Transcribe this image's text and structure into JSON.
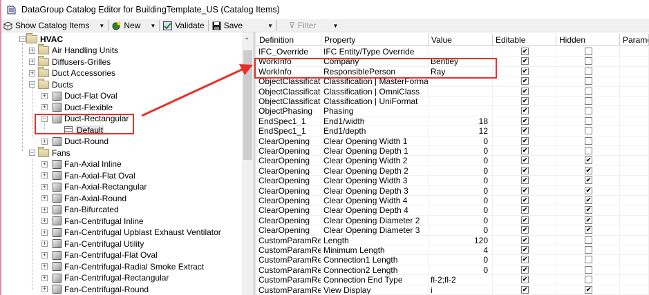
{
  "window": {
    "title": "DataGroup Catalog Editor for BuildingTemplate_US (Catalog Items)"
  },
  "toolbar": {
    "show_catalog_items": "Show Catalog Items",
    "new": "New",
    "validate": "Validate",
    "save": "Save",
    "filter": "Filter"
  },
  "tree": [
    {
      "label": "HVAC",
      "level": 1,
      "exp": "-",
      "icon": "folder",
      "bold": true
    },
    {
      "label": "Air Handling Units",
      "level": 2,
      "exp": "+",
      "icon": "folder"
    },
    {
      "label": "Diffusers-Grilles",
      "level": 2,
      "exp": "+",
      "icon": "folder"
    },
    {
      "label": "Duct Accessories",
      "level": 2,
      "exp": "+",
      "icon": "folder"
    },
    {
      "label": "Ducts",
      "level": 2,
      "exp": "-",
      "icon": "folder"
    },
    {
      "label": "Duct-Flat Oval",
      "level": 3,
      "exp": "+",
      "icon": "cube"
    },
    {
      "label": "Duct-Flexible",
      "level": 3,
      "exp": "+",
      "icon": "cube"
    },
    {
      "label": "Duct-Rectangular",
      "level": 3,
      "exp": "-",
      "icon": "cube"
    },
    {
      "label": "Default",
      "level": 4,
      "exp": "",
      "icon": "doc",
      "selected": true
    },
    {
      "label": "Duct-Round",
      "level": 3,
      "exp": "+",
      "icon": "cube"
    },
    {
      "label": "Fans",
      "level": 2,
      "exp": "-",
      "icon": "folder"
    },
    {
      "label": "Fan-Axial Inline",
      "level": 3,
      "exp": "+",
      "icon": "cube"
    },
    {
      "label": "Fan-Axial-Flat Oval",
      "level": 3,
      "exp": "+",
      "icon": "cube"
    },
    {
      "label": "Fan-Axial-Rectangular",
      "level": 3,
      "exp": "+",
      "icon": "cube"
    },
    {
      "label": "Fan-Axial-Round",
      "level": 3,
      "exp": "+",
      "icon": "cube"
    },
    {
      "label": "Fan-Bifurcated",
      "level": 3,
      "exp": "+",
      "icon": "cube"
    },
    {
      "label": "Fan-Centrifugal Inline",
      "level": 3,
      "exp": "+",
      "icon": "cube"
    },
    {
      "label": "Fan-Centrifugal Upblast Exhaust Ventilator",
      "level": 3,
      "exp": "+",
      "icon": "cube"
    },
    {
      "label": "Fan-Centrifugal Utility",
      "level": 3,
      "exp": "+",
      "icon": "cube"
    },
    {
      "label": "Fan-Centrifugal-Flat Oval",
      "level": 3,
      "exp": "+",
      "icon": "cube"
    },
    {
      "label": "Fan-Centrifugal-Radial Smoke Extract",
      "level": 3,
      "exp": "+",
      "icon": "cube"
    },
    {
      "label": "Fan-Centrifugal-Rectangular",
      "level": 3,
      "exp": "+",
      "icon": "cube"
    },
    {
      "label": "Fan-Centrifugal-Round",
      "level": 3,
      "exp": "+",
      "icon": "cube"
    }
  ],
  "grid": {
    "columns": [
      "Definition",
      "Property",
      "Value",
      "Editable",
      "Hidden",
      "Parame"
    ],
    "rows": [
      [
        "IFC_Override",
        "IFC Entity/Type Override",
        "",
        true,
        false
      ],
      [
        "WorkInfo",
        "Company",
        "Bentley",
        true,
        false
      ],
      [
        "WorkInfo",
        "ResponsiblePerson",
        "Ray",
        true,
        false
      ],
      [
        "ObjectClassificatic",
        "Classification | MasterFormat",
        "",
        true,
        false
      ],
      [
        "ObjectClassificatic",
        "Classification | OmniClass",
        "",
        true,
        false
      ],
      [
        "ObjectClassificatic",
        "Classification | UniFormat",
        "",
        true,
        false
      ],
      [
        "ObjectPhasing",
        "Phasing",
        "",
        true,
        false
      ],
      [
        "EndSpec1_1",
        "End1/width",
        "18",
        true,
        false
      ],
      [
        "EndSpec1_1",
        "End1/depth",
        "12",
        true,
        false
      ],
      [
        "ClearOpening",
        "Clear Opening Width 1",
        "0",
        true,
        false
      ],
      [
        "ClearOpening",
        "Clear Opening Depth 1",
        "0",
        true,
        false
      ],
      [
        "ClearOpening",
        "Clear Opening Width 2",
        "0",
        true,
        true
      ],
      [
        "ClearOpening",
        "Clear Opening Depth 2",
        "0",
        true,
        true
      ],
      [
        "ClearOpening",
        "Clear Opening Width 3",
        "0",
        true,
        true
      ],
      [
        "ClearOpening",
        "Clear Opening Depth 3",
        "0",
        true,
        true
      ],
      [
        "ClearOpening",
        "Clear Opening Width 4",
        "0",
        true,
        true
      ],
      [
        "ClearOpening",
        "Clear Opening Depth 4",
        "0",
        true,
        true
      ],
      [
        "ClearOpening",
        "Clear Opening Diameter 2",
        "0",
        true,
        true
      ],
      [
        "ClearOpening",
        "Clear Opening Diameter 3",
        "0",
        true,
        true
      ],
      [
        "CustomParamRec",
        "Length",
        "120",
        true,
        false
      ],
      [
        "CustomParamRec",
        "Minimum Length",
        "4",
        true,
        false
      ],
      [
        "CustomParamRec",
        "Connection1 Length",
        "0",
        true,
        false
      ],
      [
        "CustomParamRec",
        "Connection2 Length",
        "0",
        true,
        false
      ],
      [
        "CustomParamRec",
        "Connection End Type",
        "fl-2;fl-2",
        true,
        false
      ],
      [
        "CustomParamRec",
        "View Display",
        "i",
        true,
        true
      ]
    ]
  },
  "colors": {
    "highlight": "#e8302a"
  }
}
